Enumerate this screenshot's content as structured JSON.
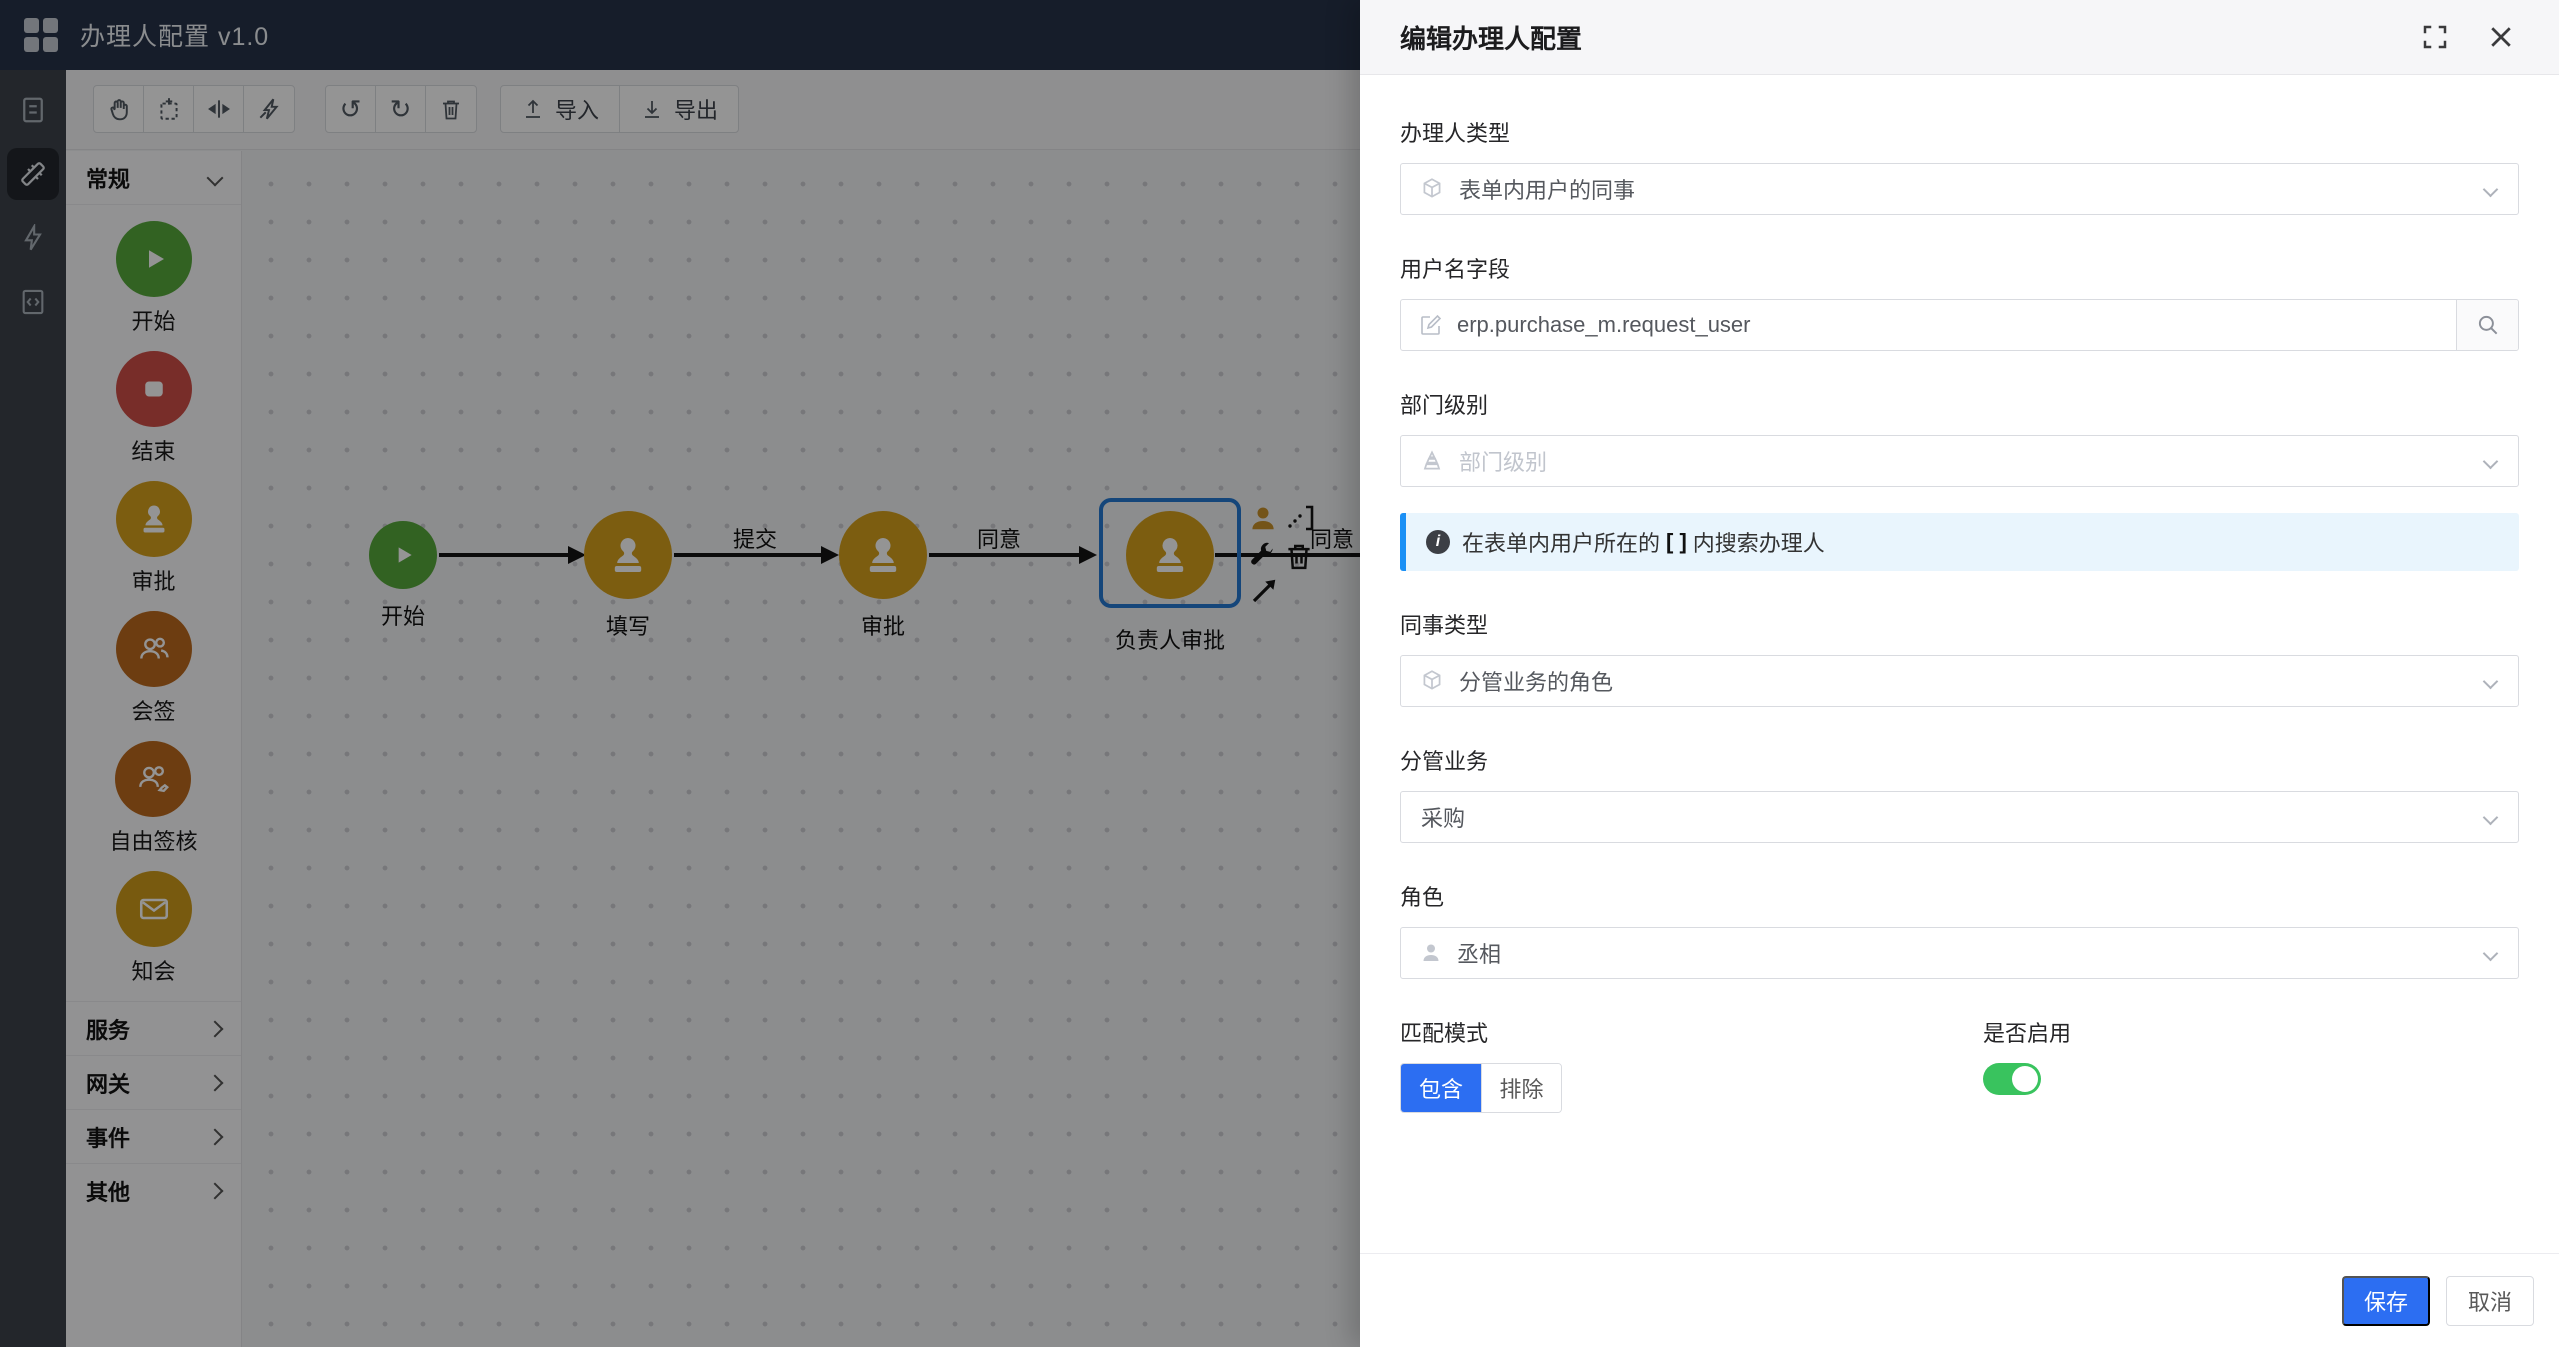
{
  "app": {
    "title": "办理人配置 v1.0"
  },
  "rail": {
    "items": [
      "form-icon",
      "design-tools-icon",
      "automation-bolt-icon",
      "code-file-icon"
    ],
    "active_index": 1
  },
  "toolbar": {
    "icons": [
      "pan-hand",
      "marquee-select",
      "split-distribute",
      "quick-connect",
      "undo",
      "redo",
      "delete"
    ],
    "import_label": "导入",
    "export_label": "导出"
  },
  "palette": {
    "group_label": "常规",
    "nodes": [
      {
        "label": "开始",
        "color": "#57a93c",
        "type": "start"
      },
      {
        "label": "结束",
        "color": "#cf4f47",
        "type": "end"
      },
      {
        "label": "审批",
        "color": "#d6a01d",
        "type": "approve"
      },
      {
        "label": "会签",
        "color": "#bc6a1e",
        "type": "countersign"
      },
      {
        "label": "自由签核",
        "color": "#bc6a1e",
        "type": "free-sign"
      },
      {
        "label": "知会",
        "color": "#cf9c1b",
        "type": "notify"
      }
    ],
    "sections": [
      {
        "label": "服务"
      },
      {
        "label": "网关"
      },
      {
        "label": "事件"
      },
      {
        "label": "其他"
      }
    ]
  },
  "canvas": {
    "nodes": [
      {
        "label": "开始",
        "type": "start"
      },
      {
        "label": "填写",
        "type": "task"
      },
      {
        "label": "审批",
        "type": "task"
      },
      {
        "label": "负责人审批",
        "type": "task",
        "selected": true
      }
    ],
    "edges": [
      {
        "label": "提交"
      },
      {
        "label": "同意"
      },
      {
        "label": "同意"
      }
    ],
    "selection_color": "#2579d2",
    "context_icons": [
      "assignee-person",
      "link-bracket",
      "wrench",
      "trash",
      "arrow-connect"
    ]
  },
  "drawer": {
    "title": "编辑办理人配置",
    "fields": {
      "handler_type": {
        "label": "办理人类型",
        "value": "表单内用户的同事",
        "icon": "cube-icon"
      },
      "username_field": {
        "label": "用户名字段",
        "value": "erp.purchase_m.request_user",
        "icon": "edit-icon",
        "addon_icon": "search-icon"
      },
      "dept_level": {
        "label": "部门级别",
        "placeholder": "部门级别",
        "icon": "level-pyramid-icon"
      },
      "banner": {
        "prefix": "在表单内用户所在的",
        "highlight": "[ ]",
        "suffix": "内搜索办理人",
        "icon": "info-icon"
      },
      "colleague_type": {
        "label": "同事类型",
        "value": "分管业务的角色",
        "icon": "cube-icon"
      },
      "business": {
        "label": "分管业务",
        "value": "采购"
      },
      "role": {
        "label": "角色",
        "value": "丞相",
        "icon": "person-icon"
      },
      "match_mode": {
        "label": "匹配模式",
        "options": [
          {
            "label": "包含",
            "selected": true
          },
          {
            "label": "排除",
            "selected": false
          }
        ]
      },
      "enabled": {
        "label": "是否启用",
        "value": true,
        "on_color": "#39c35e"
      }
    },
    "footer": {
      "save_label": "保存",
      "cancel_label": "取消"
    },
    "accent_color": "#2c6ef2"
  }
}
